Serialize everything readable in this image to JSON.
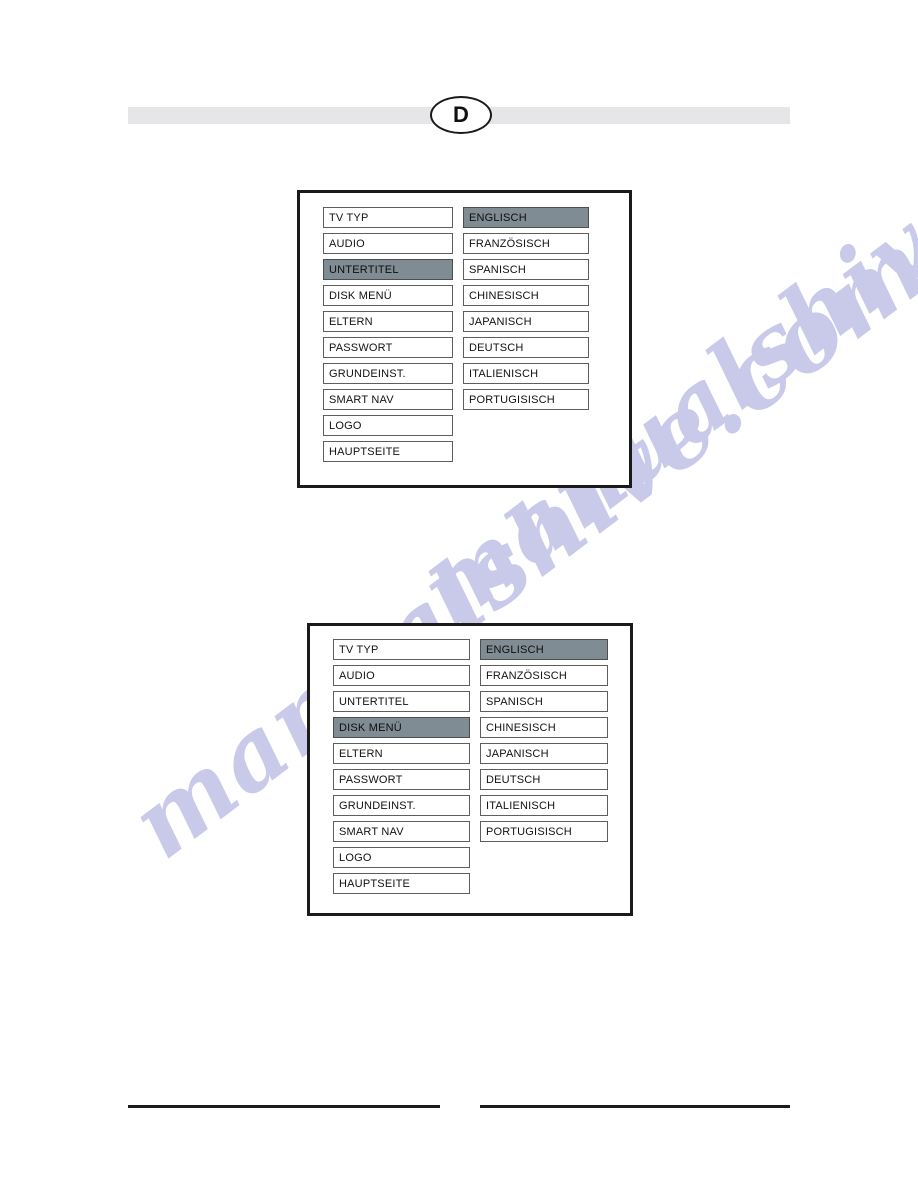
{
  "page": {
    "language_badge": "D",
    "watermark_text": "manualshive.com"
  },
  "osd_screens": [
    {
      "name": "setup-menu-subtitle-selected",
      "menu_column": {
        "items": [
          {
            "label": "TV TYP",
            "selected": false
          },
          {
            "label": "AUDIO",
            "selected": false
          },
          {
            "label": "UNTERTITEL",
            "selected": true
          },
          {
            "label": "DISK MENÜ",
            "selected": false
          },
          {
            "label": "ELTERN",
            "selected": false
          },
          {
            "label": "PASSWORT",
            "selected": false
          },
          {
            "label": "GRUNDEINST.",
            "selected": false
          },
          {
            "label": "SMART NAV",
            "selected": false
          },
          {
            "label": "LOGO",
            "selected": false
          },
          {
            "label": "HAUPTSEITE",
            "selected": false
          }
        ]
      },
      "language_column": {
        "items": [
          {
            "label": "ENGLISCH",
            "selected": true
          },
          {
            "label": "FRANZÖSISCH",
            "selected": false
          },
          {
            "label": "SPANISCH",
            "selected": false
          },
          {
            "label": "CHINESISCH",
            "selected": false
          },
          {
            "label": "JAPANISCH",
            "selected": false
          },
          {
            "label": "DEUTSCH",
            "selected": false
          },
          {
            "label": "ITALIENISCH",
            "selected": false
          },
          {
            "label": "PORTUGISISCH",
            "selected": false
          }
        ]
      }
    },
    {
      "name": "setup-menu-disc-menu-selected",
      "menu_column": {
        "items": [
          {
            "label": "TV TYP",
            "selected": false
          },
          {
            "label": "AUDIO",
            "selected": false
          },
          {
            "label": "UNTERTITEL",
            "selected": false
          },
          {
            "label": "DISK MENÜ",
            "selected": true
          },
          {
            "label": "ELTERN",
            "selected": false
          },
          {
            "label": "PASSWORT",
            "selected": false
          },
          {
            "label": "GRUNDEINST.",
            "selected": false
          },
          {
            "label": "SMART NAV",
            "selected": false
          },
          {
            "label": "LOGO",
            "selected": false
          },
          {
            "label": "HAUPTSEITE",
            "selected": false
          }
        ]
      },
      "language_column": {
        "items": [
          {
            "label": "ENGLISCH",
            "selected": true
          },
          {
            "label": "FRANZÖSISCH",
            "selected": false
          },
          {
            "label": "SPANISCH",
            "selected": false
          },
          {
            "label": "CHINESISCH",
            "selected": false
          },
          {
            "label": "JAPANISCH",
            "selected": false
          },
          {
            "label": "DEUTSCH",
            "selected": false
          },
          {
            "label": "ITALIENISCH",
            "selected": false
          },
          {
            "label": "PORTUGISISCH",
            "selected": false
          }
        ]
      }
    }
  ],
  "colors": {
    "highlight": "#808c94",
    "header_band": "#e6e6e8",
    "rule": "#1b1b1b",
    "watermark": "#c9c9ea"
  }
}
